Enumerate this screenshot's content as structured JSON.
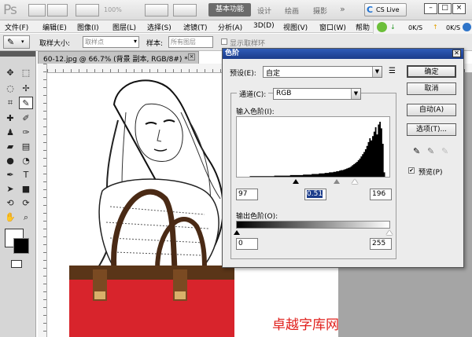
{
  "titlebar": {
    "logo": "Ps",
    "zoom": "100%",
    "workspaces": [
      "基本功能",
      "设计",
      "绘画",
      "摄影"
    ],
    "more": "»",
    "cs_live": "CS Live",
    "win_min": "–",
    "win_max": "□",
    "win_close": "×"
  },
  "menu": [
    "文件(F)",
    "编辑(E)",
    "图像(I)",
    "图层(L)",
    "选择(S)",
    "滤镜(T)",
    "分析(A)",
    "3D(D)",
    "视图(V)",
    "窗口(W)",
    "帮助"
  ],
  "net": {
    "down": "0K/S",
    "up": "0K/S"
  },
  "options": {
    "sample_size_label": "取样大小:",
    "sample_size_value": "取样点",
    "sample_label": "样本:",
    "sample_value": "所有图层",
    "show_ring_label": "显示取样环"
  },
  "document": {
    "tab_label": "60-12.jpg @ 66.7% (背景 副本, RGB/8#) *",
    "watermark": "卓越字库网"
  },
  "dialog": {
    "title": "色阶",
    "preset_label": "预设(E):",
    "preset_value": "自定",
    "channel_label": "通道(C):",
    "channel_value": "RGB",
    "input_label": "输入色阶(I):",
    "input_black": "97",
    "input_gamma": "0.51",
    "input_white": "196",
    "output_label": "输出色阶(O):",
    "output_black": "0",
    "output_white": "255",
    "buttons": {
      "ok": "确定",
      "cancel": "取消",
      "auto": "自动(A)",
      "options": "选项(T)..."
    },
    "preview_label": "预览(P)",
    "preview_checked": true,
    "histogram": [
      0,
      0,
      0,
      0,
      0,
      0,
      0,
      0,
      0,
      1,
      1,
      1,
      1,
      1,
      1,
      1,
      1,
      1,
      1,
      1,
      1,
      1,
      1,
      1,
      1,
      1,
      2,
      2,
      2,
      2,
      2,
      2,
      2,
      2,
      2,
      2,
      2,
      3,
      3,
      3,
      3,
      3,
      3,
      3,
      3,
      3,
      4,
      4,
      4,
      4,
      4,
      4,
      5,
      5,
      5,
      5,
      5,
      6,
      6,
      6,
      6,
      7,
      7,
      7,
      8,
      8,
      8,
      9,
      9,
      10,
      10,
      11,
      12,
      12,
      13,
      14,
      15,
      16,
      17,
      19,
      21,
      23,
      25,
      27,
      30,
      33,
      37,
      41,
      45,
      50,
      56,
      63,
      70,
      66,
      74,
      82,
      90,
      77,
      95,
      100,
      88,
      60,
      8,
      0,
      0,
      0
    ]
  }
}
